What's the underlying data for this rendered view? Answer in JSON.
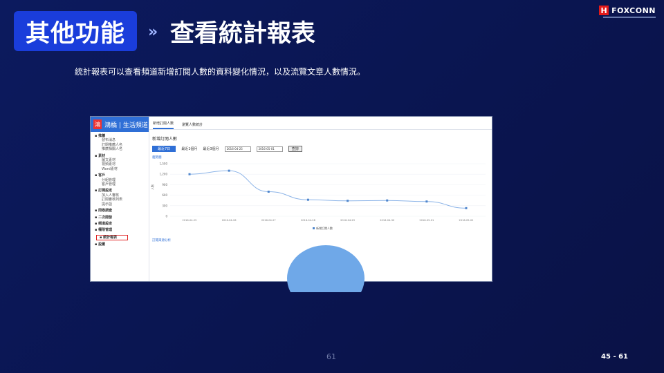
{
  "slide": {
    "title": "其他功能",
    "subtitle": "查看統計報表",
    "chevrons": "»",
    "logo_mark": "H",
    "logo_text": "FOXCONN",
    "description": "統計報表可以查看頻道新增訂閱人數的資料變化情況，以及流覽文章人數情況。",
    "page_center": "61",
    "page_right": "45 - 61"
  },
  "app": {
    "brand_icon": "鴻",
    "brand_name": "鴻橋 | 生活頻道",
    "menu": [
      {
        "group": "推薦",
        "items": [
          "發布消息",
          "訂閱推薦人名",
          "推廣相關人名"
        ]
      },
      {
        "group": "素材",
        "items": [
          "圖文素材",
          "視頻素材",
          "Word素材"
        ]
      },
      {
        "group": "客戶",
        "items": [
          "分組管理",
          "客戶管理"
        ]
      },
      {
        "group": "訂閱設定",
        "items": [
          "加入人審核",
          "訂閱審核列表",
          "提示語"
        ]
      },
      {
        "group": "問卷調查",
        "items": []
      },
      {
        "group": "二次開發",
        "items": []
      },
      {
        "group": "頻道設定",
        "items": []
      },
      {
        "group": "權限管理",
        "items": []
      },
      {
        "group": "統計報表",
        "items": []
      },
      {
        "group": "設置",
        "items": []
      }
    ],
    "tabs": [
      "新增訂閱人數",
      "瀏覽人數統計"
    ],
    "panel_title": "新增訂閱人數",
    "filters": {
      "active": "最近7日",
      "opt1": "最近1個月",
      "opt2": "最近3個月",
      "date_from": "2016-04-25",
      "date_to": "2016-05-01",
      "query": "查詢"
    },
    "chart_section_label": "趨勢圖",
    "pie_section_label": "訂閱來源分析"
  },
  "chart_data": [
    {
      "type": "line",
      "title": "",
      "xlabel": "",
      "ylabel": "人數",
      "x": [
        "2016-04-25",
        "2016-04-26",
        "2016-04-27",
        "2016-04-28",
        "2016-04-29",
        "2016-04-30",
        "2016-05-01",
        "2016-05-02"
      ],
      "series": [
        {
          "name": "新增訂閱人數",
          "values": [
            1200,
            1300,
            700,
            470,
            440,
            450,
            420,
            230
          ]
        }
      ],
      "yticks": [
        "1,500",
        "1,200",
        "900",
        "600",
        "300",
        "0"
      ],
      "ylim": [
        0,
        1500
      ],
      "grid": true,
      "legend": "bottom",
      "color": "#8cb4e8"
    },
    {
      "type": "pie",
      "title": "",
      "series": [
        {
          "name": "",
          "values": [
            100
          ]
        }
      ],
      "color": "#6fa8e8"
    }
  ]
}
